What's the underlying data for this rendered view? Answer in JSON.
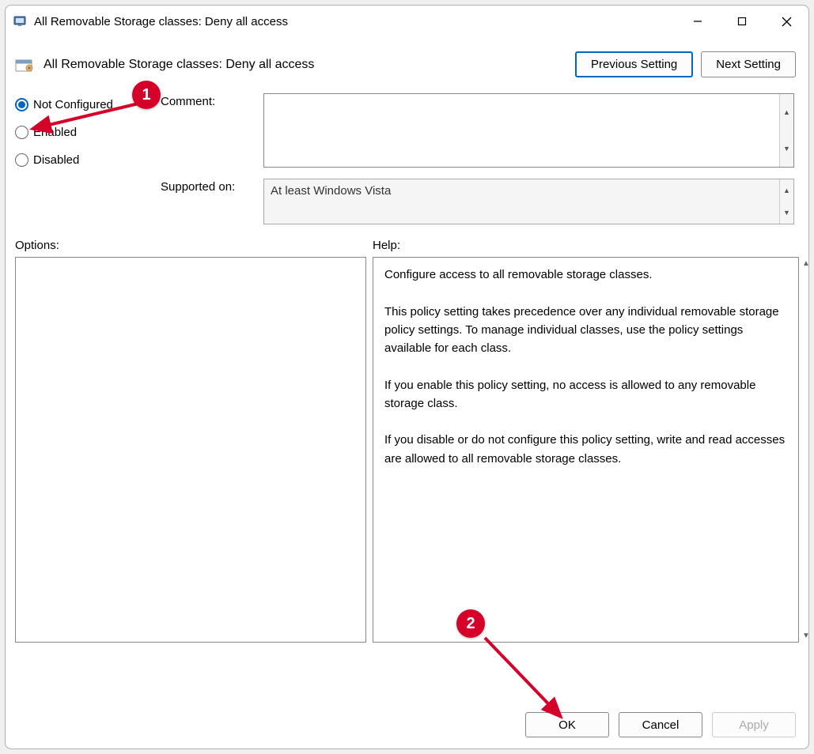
{
  "window": {
    "title": "All Removable Storage classes: Deny all access"
  },
  "header": {
    "title": "All Removable Storage classes: Deny all access",
    "prev": "Previous Setting",
    "next": "Next Setting"
  },
  "radios": {
    "not_configured": "Not Configured",
    "enabled": "Enabled",
    "disabled": "Disabled",
    "selected": "not_configured"
  },
  "fields": {
    "comment_label": "Comment:",
    "comment_value": "",
    "supported_label": "Supported on:",
    "supported_value": "At least Windows Vista"
  },
  "sections": {
    "options": "Options:",
    "help": "Help:"
  },
  "help_text": "Configure access to all removable storage classes.\n\nThis policy setting takes precedence over any individual removable storage policy settings. To manage individual classes, use the policy settings available for each class.\n\nIf you enable this policy setting, no access is allowed to any removable storage class.\n\nIf you disable or do not configure this policy setting, write and read accesses are allowed to all removable storage classes.",
  "footer": {
    "ok": "OK",
    "cancel": "Cancel",
    "apply": "Apply"
  },
  "annotations": {
    "badge1": "1",
    "badge2": "2"
  }
}
